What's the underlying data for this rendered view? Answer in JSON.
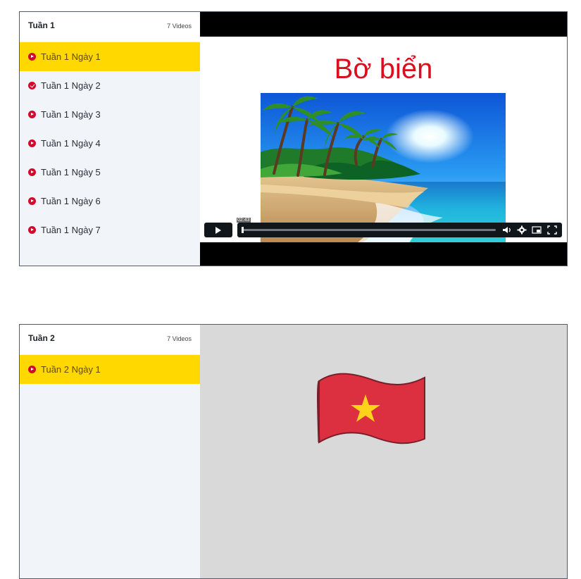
{
  "modules": [
    {
      "title": "Tuần 1",
      "count_label": "7 Videos",
      "lessons": [
        {
          "label": "Tuần 1 Ngày 1",
          "state": "active",
          "icon": "play-circle-icon"
        },
        {
          "label": "Tuần 1 Ngày 2",
          "state": "completed",
          "icon": "check-circle-icon"
        },
        {
          "label": "Tuần 1 Ngày 3",
          "state": "default",
          "icon": "play-circle-icon"
        },
        {
          "label": "Tuần 1 Ngày 4",
          "state": "default",
          "icon": "play-circle-icon"
        },
        {
          "label": "Tuần 1 Ngày 5",
          "state": "default",
          "icon": "play-circle-icon"
        },
        {
          "label": "Tuần 1 Ngày 6",
          "state": "default",
          "icon": "play-circle-icon"
        },
        {
          "label": "Tuần 1 Ngày 7",
          "state": "default",
          "icon": "play-circle-icon"
        }
      ],
      "video": {
        "slide_title": "Bờ biển",
        "current_time": "02:43",
        "progress_fraction": 0,
        "controls": [
          "play-icon",
          "volume-icon",
          "settings-icon",
          "picture-in-picture-icon",
          "fullscreen-icon"
        ]
      }
    },
    {
      "title": "Tuần 2",
      "count_label": "7 Videos",
      "lessons": [
        {
          "label": "Tuần 2 Ngày 1",
          "state": "active",
          "icon": "play-circle-icon"
        }
      ],
      "preview": {
        "icon": "vietnam-flag-icon"
      }
    }
  ],
  "colors": {
    "accent_yellow": "#ffd800",
    "icon_red": "#d4082d",
    "slide_title_red": "#d90f1d",
    "sidebar_bg": "#f1f5fa",
    "player_bg": "#000000",
    "control_bg": "#11161b"
  }
}
